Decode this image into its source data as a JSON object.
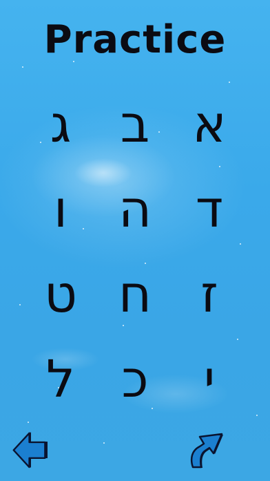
{
  "screen": {
    "title": "Practice"
  },
  "letters": [
    "א",
    "ב",
    "ג",
    "ד",
    "ה",
    "ו",
    "ז",
    "ח",
    "ט",
    "י",
    "כ",
    "ל"
  ],
  "navigation": {
    "back_icon": "left-arrow-icon",
    "forward_icon": "curved-forward-arrow-icon"
  },
  "colors": {
    "background": "#3aa9ea",
    "text": "#0b0b12",
    "arrow_fill": "#1b7fd0",
    "arrow_outline": "#0a1430"
  }
}
